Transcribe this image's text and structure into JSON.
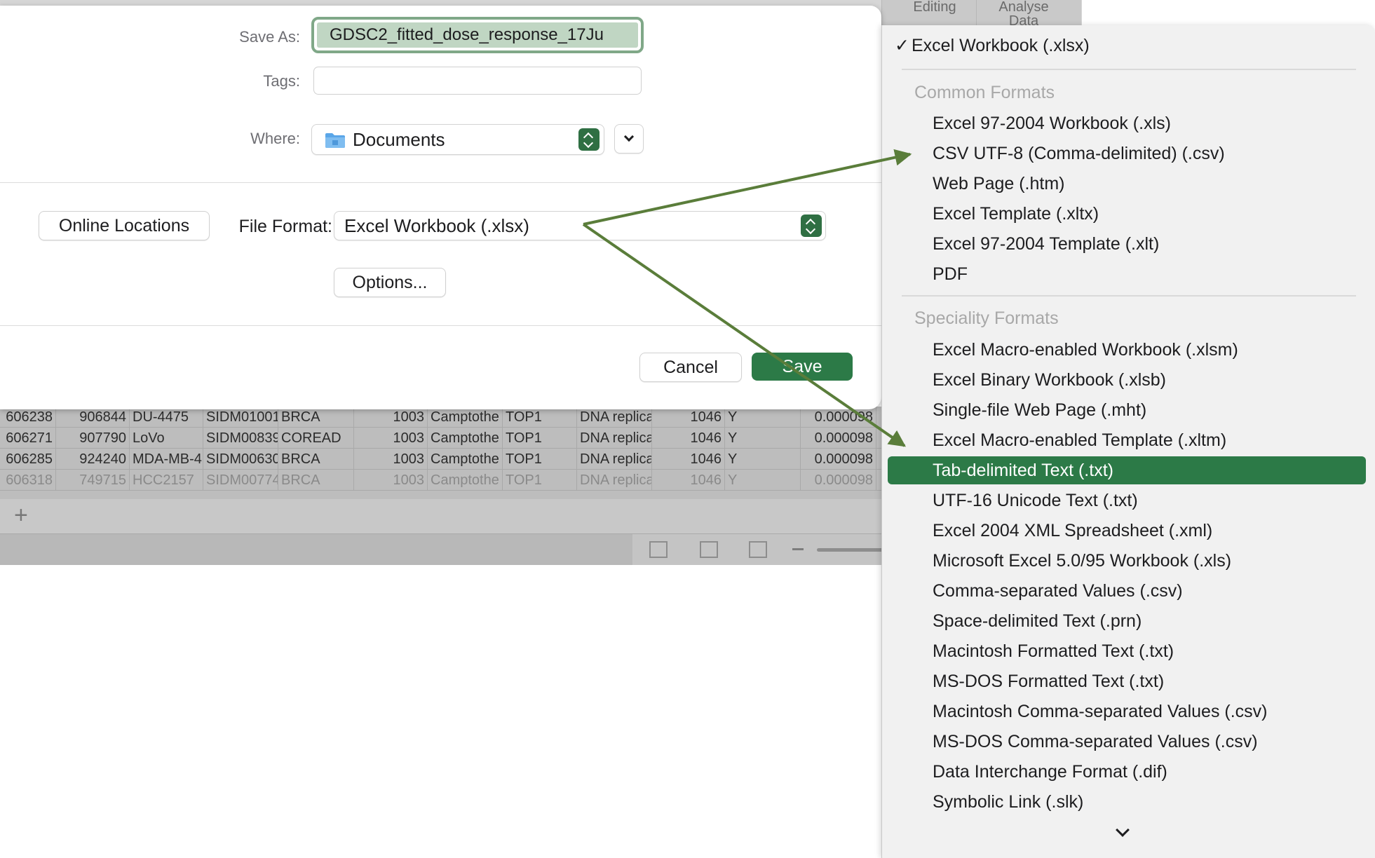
{
  "ribbon": {
    "tabs": [
      "Editing",
      "Analyse Data"
    ]
  },
  "sheet": {
    "rows": [
      [
        "606238",
        "906844",
        "DU-4475",
        "SIDM01001",
        "BRCA",
        "1003",
        "Camptothe",
        "TOP1",
        "DNA replica",
        "1046",
        "Y",
        "0.000098"
      ],
      [
        "606271",
        "907790",
        "LoVo",
        "SIDM00839",
        "COREAD",
        "1003",
        "Camptothe",
        "TOP1",
        "DNA replica",
        "1046",
        "Y",
        "0.000098"
      ],
      [
        "606285",
        "924240",
        "MDA-MB-4",
        "SIDM00630",
        "BRCA",
        "1003",
        "Camptothe",
        "TOP1",
        "DNA replica",
        "1046",
        "Y",
        "0.000098"
      ],
      [
        "606318",
        "749715",
        "HCC2157",
        "SIDM00774",
        "BRCA",
        "1003",
        "Camptothe",
        "TOP1",
        "DNA replica",
        "1046",
        "Y",
        "0.000098"
      ]
    ],
    "add_sheet_label": "+"
  },
  "dialog": {
    "save_as_label": "Save As:",
    "save_as_value": "GDSC2_fitted_dose_response_17Ju",
    "tags_label": "Tags:",
    "tags_value": "",
    "where_label": "Where:",
    "where_value": "Documents",
    "online_locations_label": "Online Locations",
    "file_format_label": "File Format:",
    "file_format_value": "Excel Workbook (.xlsx)",
    "options_label": "Options...",
    "cancel_label": "Cancel",
    "save_label": "Save"
  },
  "format_menu": {
    "checked_item": "Excel Workbook (.xlsx)",
    "common_header": "Common Formats",
    "common_items": [
      "Excel 97-2004 Workbook (.xls)",
      "CSV UTF-8 (Comma-delimited) (.csv)",
      "Web Page (.htm)",
      "Excel Template (.xltx)",
      "Excel 97-2004 Template (.xlt)",
      "PDF"
    ],
    "speciality_header": "Speciality Formats",
    "speciality_items": [
      "Excel Macro-enabled Workbook (.xlsm)",
      "Excel Binary Workbook (.xlsb)",
      "Single-file Web Page (.mht)",
      "Excel Macro-enabled Template (.xltm)",
      "Tab-delimited Text (.txt)",
      "UTF-16 Unicode Text (.txt)",
      "Excel 2004 XML Spreadsheet (.xml)",
      "Microsoft Excel 5.0/95 Workbook (.xls)",
      "Comma-separated Values (.csv)",
      "Space-delimited Text (.prn)",
      "Macintosh Formatted Text (.txt)",
      "MS-DOS Formatted Text (.txt)",
      "Macintosh Comma-separated Values (.csv)",
      "MS-DOS Comma-separated Values (.csv)",
      "Data Interchange Format (.dif)",
      "Symbolic Link (.slk)"
    ],
    "selected_item": "Tab-delimited Text (.txt)"
  },
  "colors": {
    "accent_green": "#2c7a47",
    "arrow_green": "#5a7d3a",
    "focus_ring": "#80a888"
  },
  "icons": [
    "folder-icon",
    "stepper-icon",
    "chevron-down-icon",
    "checkmark-icon",
    "grid-view-icon",
    "page-layout-icon",
    "page-break-icon",
    "zoom-out-icon",
    "plus-icon"
  ]
}
